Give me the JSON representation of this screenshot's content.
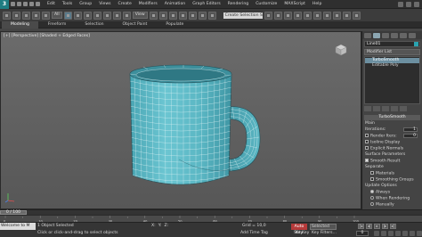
{
  "menubar": {
    "logo": "3",
    "items": [
      "Edit",
      "Tools",
      "Group",
      "Views",
      "Create",
      "Modifiers",
      "Animation",
      "Graph Editors",
      "Rendering",
      "Customize",
      "MAXScript",
      "Help"
    ],
    "search_text": "Create Selection Se"
  },
  "toolbar": {
    "filter_value": "All",
    "view_value": "View"
  },
  "ribbon": {
    "tabs": [
      "Modeling",
      "Freeform",
      "Selection",
      "Object Paint",
      "Populate"
    ]
  },
  "viewport": {
    "label": "[+] [Perspective] [Shaded + Edged Faces]"
  },
  "command_panel": {
    "object_name": "Line01",
    "modifier_list": "Modifier List",
    "stack": [
      {
        "label": "TurboSmooth",
        "highlight": true
      },
      {
        "label": "Editable Poly",
        "highlight": false
      }
    ],
    "rollout_title": "TurboSmooth",
    "main_label": "Main",
    "iterations_label": "Iterations:",
    "iterations_value": "1",
    "render_iters_label": "Render Iters:",
    "render_iters_value": "0",
    "isoline_label": "Isoline Display",
    "explicit_normals_label": "Explicit Normals",
    "surface_params_label": "Surface Parameters",
    "smooth_result_label": "Smooth Result",
    "separate_label": "Separate",
    "materials_label": "Materials",
    "smoothing_groups_label": "Smoothing Groups",
    "update_options_label": "Update Options",
    "always_label": "Always",
    "when_rendering_label": "When Rendering",
    "manually_label": "Manually"
  },
  "timeline": {
    "slider_text": "0 / 100",
    "tick_labels": [
      "0",
      "10",
      "20",
      "30",
      "40",
      "50",
      "60",
      "70",
      "80",
      "90",
      "100"
    ]
  },
  "status": {
    "mini_listener": "Welcome to M",
    "selection": "1 Object Selected",
    "prompt": "Click or click-and-drag to select objects",
    "x_label": "X:",
    "y_label": "Y:",
    "z_label": "Z:",
    "grid": "Grid = 10,0",
    "add_time_tag": "Add Time Tag",
    "auto_key": "Auto Key",
    "selected": "Selected",
    "set_key": "Set Key",
    "key_filters": "Key Filters...",
    "frame": "0"
  }
}
